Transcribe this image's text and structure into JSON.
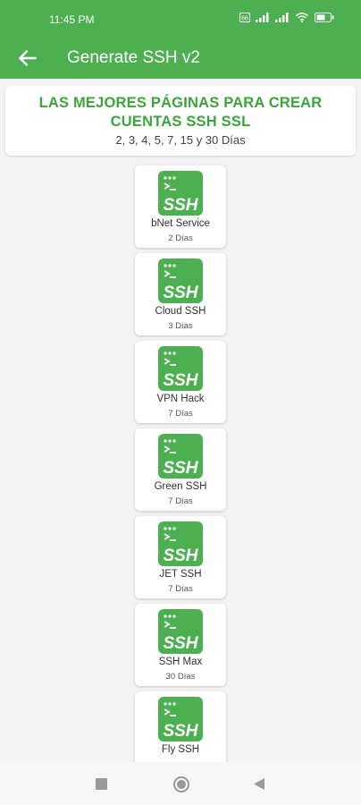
{
  "status": {
    "time": "11:45 PM",
    "battery_icon": "battery-icon",
    "wifi_icon": "wifi-icon",
    "signal_icon": "signal-icon"
  },
  "appbar": {
    "title": "Generate SSH v2",
    "back_icon": "back-arrow-icon"
  },
  "header": {
    "title_line1": "LAS MEJORES PÁGINAS PARA CREAR",
    "title_line2": "CUENTAS SSH SSL",
    "subtitle": "2, 3, 4, 5, 7, 15 y 30 Días"
  },
  "services": [
    {
      "name": "bNet Service",
      "days": "2 Días"
    },
    {
      "name": "Cloud SSH",
      "days": "3 Días"
    },
    {
      "name": "VPN Hack",
      "days": "7 Días"
    },
    {
      "name": "Green SSH",
      "days": "7 Días"
    },
    {
      "name": "JET SSH",
      "days": "7 Días"
    },
    {
      "name": "SSH Max",
      "days": "30 Días"
    },
    {
      "name": "Fly SSH",
      "days": ""
    }
  ],
  "logo_text": "SSH",
  "colors": {
    "primary": "#4caf50",
    "title_green": "#3aa63a"
  }
}
